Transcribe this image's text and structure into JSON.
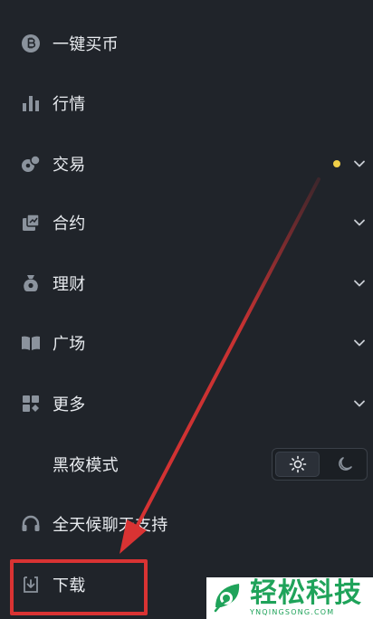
{
  "menu": {
    "items": [
      {
        "label": "一键买币",
        "icon": "bitcoin-coin-icon"
      },
      {
        "label": "行情",
        "icon": "bar-chart-icon"
      },
      {
        "label": "交易",
        "icon": "exchange-icon",
        "badge_color": "#f0cf48"
      },
      {
        "label": "合约",
        "icon": "contract-icon"
      },
      {
        "label": "理财",
        "icon": "money-bag-icon"
      },
      {
        "label": "广场",
        "icon": "open-book-icon"
      },
      {
        "label": "更多",
        "icon": "grid-more-icon"
      },
      {
        "label": "黑夜模式",
        "icon": ""
      },
      {
        "label": "全天候聊天支持",
        "icon": "headset-icon"
      },
      {
        "label": "下载",
        "icon": "download-icon"
      }
    ]
  },
  "theme_toggle": {
    "options": [
      "sun-icon",
      "moon-icon"
    ],
    "selected": "sun-icon"
  },
  "watermark": {
    "title": "轻松科技",
    "subtitle": "YNQINGSONG.COM"
  },
  "colors": {
    "background": "#20242a",
    "text": "#e8ebef",
    "icon": "#8b939d",
    "badge": "#f0cf48",
    "annotation": "#d93333",
    "watermark": "#1fa35a"
  }
}
